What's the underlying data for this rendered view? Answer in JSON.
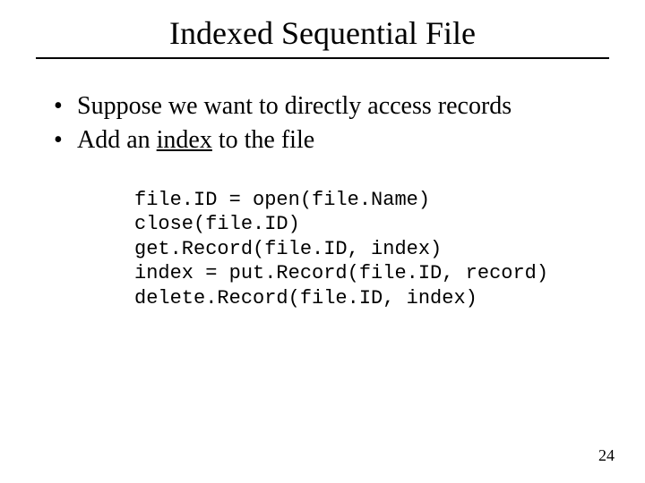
{
  "title": "Indexed Sequential File",
  "bullets": [
    {
      "pre": "Suppose we want to directly access records",
      "underlined": "",
      "post": ""
    },
    {
      "pre": "Add an ",
      "underlined": "index",
      "post": " to the file"
    }
  ],
  "code": [
    "file.ID = open(file.Name)",
    "close(file.ID)",
    "get.Record(file.ID, index)",
    "index = put.Record(file.ID, record)",
    "delete.Record(file.ID, index)"
  ],
  "page_number": "24"
}
